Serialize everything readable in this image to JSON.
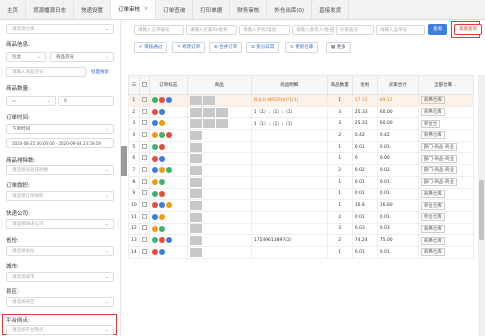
{
  "tabs": [
    {
      "label": "主页",
      "active": false
    },
    {
      "label": "货源播源日志",
      "active": false
    },
    {
      "label": "快递设置",
      "active": false
    },
    {
      "label": "订单审核",
      "active": true
    },
    {
      "label": "订单查询",
      "active": false
    },
    {
      "label": "打印单据",
      "active": false
    },
    {
      "label": "财务审核",
      "active": false
    },
    {
      "label": "外仓出库(0)",
      "active": false
    },
    {
      "label": "直接发货",
      "active": false
    }
  ],
  "tab_close": "×",
  "left_panel": {
    "top_placeholder": "请选择仓库",
    "product_info_label": "商品信息:",
    "product_info_mode": "包含",
    "product_info_scope": "商品货号",
    "product_code_placeholder": "请输入商品货号",
    "batch_search_link": "批量搜索",
    "product_qty_label": "商品数量:",
    "qty_op": "=",
    "qty_value": "0",
    "order_time_label": "订单时间:",
    "order_time_type": "下单时间",
    "time_range": "2020-08-25 00:00:00 - 2020-09-04 23:59:59",
    "exclude_label": "商品排除数:",
    "exclude_placeholder": "请选择商品排除数",
    "order_flag_label": "订单旗帜:",
    "order_flag_placeholder": "请选择订单旗帜",
    "express_label": "快递公司:",
    "express_placeholder": "请选择快递公司",
    "province_label": "省份:",
    "province_placeholder": "请选择省份",
    "city_label": "城市:",
    "city_placeholder": "请选择城市",
    "district_label": "县区:",
    "district_placeholder": "请选择县区",
    "platform_label": "平台网点:",
    "platform_placeholder": "请选择平台网点"
  },
  "search": {
    "order_no": "请输入订单编号",
    "buyer": "请输入买家ID/昵称",
    "phone": "请输入手机/电话",
    "recipient": "请输入收货人/姓名",
    "note": "买家备注",
    "waybill": "请输入运单号",
    "query_btn": "查询",
    "advanced_btn": "高级查询"
  },
  "toolbar": {
    "review": "审核通过",
    "edit": "修改订单",
    "merge": "合并订单",
    "split": "拆分异常",
    "refresh": "更新仓库",
    "more": "更多"
  },
  "table": {
    "headers": [
      "订单标志",
      "商品",
      "商品明细",
      "商品数量",
      "毛利",
      "买家合计",
      "全部仓库"
    ],
    "rows": [
      {
        "num": "1",
        "detail": "N-JLD-NRDP(0)*1(1)",
        "qty": "1",
        "profit": "57.12",
        "total": "89.12",
        "wh": "商弗仓库",
        "hl": true
      },
      {
        "num": "2",
        "detail": "1（1）;（1）;（1）",
        "qty": "3",
        "profit": "25.33",
        "total": "60.00",
        "wh": "商弗仓库",
        "hl": false
      },
      {
        "num": "3",
        "detail": "1（1）;（1）;（1）",
        "qty": "3",
        "profit": "25.33",
        "total": "60.00",
        "wh": "单位仓",
        "hl": false
      },
      {
        "num": "4",
        "detail": "",
        "qty": "2",
        "profit": "0.42",
        "total": "0.42",
        "wh": "商弗仓库",
        "hl": false
      },
      {
        "num": "5",
        "detail": "",
        "qty": "1",
        "profit": "0.01",
        "total": "0.01",
        "wh": "部门-商品-商业",
        "hl": false
      },
      {
        "num": "6",
        "detail": "",
        "qty": "1",
        "profit": "0",
        "total": "0.00",
        "wh": "部门-商品-商业",
        "hl": false
      },
      {
        "num": "7",
        "detail": "",
        "qty": "2",
        "profit": "0.02",
        "total": "0.02",
        "wh": "部门-商品-商业",
        "hl": false
      },
      {
        "num": "8",
        "detail": "",
        "qty": "1",
        "profit": "0.01",
        "total": "0.01",
        "wh": "部门-商品-商业",
        "hl": false
      },
      {
        "num": "9",
        "detail": "",
        "qty": "1",
        "profit": "0.01",
        "total": "0.01",
        "wh": "商弗仓库",
        "hl": false
      },
      {
        "num": "10",
        "detail": "",
        "qty": "1",
        "profit": "16.8",
        "total": "16.80",
        "wh": "单位仓库",
        "hl": false
      },
      {
        "num": "11",
        "detail": "",
        "qty": "2",
        "profit": "0.01",
        "total": "0.01",
        "wh": "单位仓库",
        "hl": false
      },
      {
        "num": "12",
        "detail": "",
        "qty": "3",
        "profit": "0.03",
        "total": "0.03",
        "wh": "商弗仓库",
        "hl": false
      },
      {
        "num": "13",
        "detail": "17549613897(2)",
        "qty": "2",
        "profit": "74.24",
        "total": "75.00",
        "wh": "商弗仓库",
        "hl": false
      },
      {
        "num": "14",
        "detail": "",
        "qty": "1",
        "profit": "0.01",
        "total": "0.01",
        "wh": "商弗仓库",
        "hl": false
      }
    ]
  },
  "colors": {
    "accent": "#3a7ee0",
    "highlight": "#e53935"
  }
}
